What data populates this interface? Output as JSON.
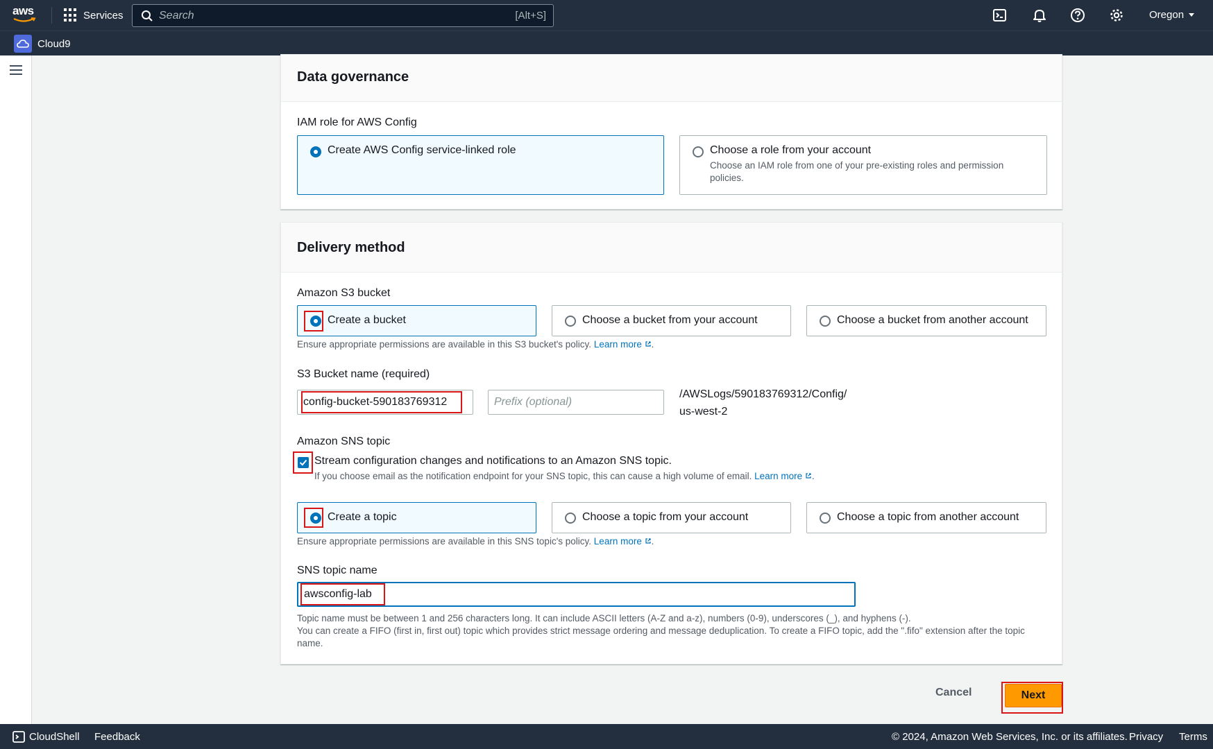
{
  "nav": {
    "logo": "aws",
    "services": "Services",
    "search_placeholder": "Search",
    "search_shortcut": "[Alt+S]",
    "region": "Oregon",
    "icons": [
      "cloudshell-icon",
      "bell-icon",
      "help-icon",
      "gear-icon"
    ]
  },
  "subnav": {
    "service": "Cloud9"
  },
  "governance": {
    "title": "Data governance",
    "iam_label": "IAM role for AWS Config",
    "option1": "Create AWS Config service-linked role",
    "option2": "Choose a role from your account",
    "option2_desc": "Choose an IAM role from one of your pre-existing roles and permission policies."
  },
  "delivery": {
    "title": "Delivery method",
    "s3_label": "Amazon S3 bucket",
    "s3_opt1": "Create a bucket",
    "s3_opt2": "Choose a bucket from your account",
    "s3_opt3": "Choose a bucket from another account",
    "s3_hint": "Ensure appropriate permissions are available in this S3 bucket's policy.",
    "learn_more": "Learn more",
    "bucket_name_label": "S3 Bucket name (required)",
    "bucket_name_value": "config-bucket-590183769312",
    "prefix_placeholder": "Prefix (optional)",
    "path_suffix_1": "/AWSLogs/590183769312/Config/",
    "path_suffix_2": "us-west-2",
    "sns_label": "Amazon SNS topic",
    "sns_checkbox": "Stream configuration changes and notifications to an Amazon SNS topic.",
    "sns_checkbox_hint": "If you choose email as the notification endpoint for your SNS topic, this can cause a high volume of email.",
    "sns_opt1": "Create a topic",
    "sns_opt2": "Choose a topic from your account",
    "sns_opt3": "Choose a topic from another account",
    "sns_hint": "Ensure appropriate permissions are available in this SNS topic's policy.",
    "topic_name_label": "SNS topic name",
    "topic_name_value": "awsconfig-lab",
    "topic_rule_1": "Topic name must be between 1 and 256 characters long. It can include ASCII letters (A-Z and a-z), numbers (0-9), underscores (_), and hyphens (-).",
    "topic_rule_2": "You can create a FIFO (first in, first out) topic which provides strict message ordering and message deduplication. To create a FIFO topic, add the \".fifo\" extension after the topic name."
  },
  "actions": {
    "cancel": "Cancel",
    "next": "Next"
  },
  "footer": {
    "cloudshell": "CloudShell",
    "feedback": "Feedback",
    "copyright": "© 2024, Amazon Web Services, Inc. or its affiliates.",
    "privacy": "Privacy",
    "terms": "Terms"
  },
  "colors": {
    "accent": "#0073bb",
    "primary_button": "#ff9900",
    "highlight": "#d91515",
    "header_bg": "#232f3e"
  }
}
